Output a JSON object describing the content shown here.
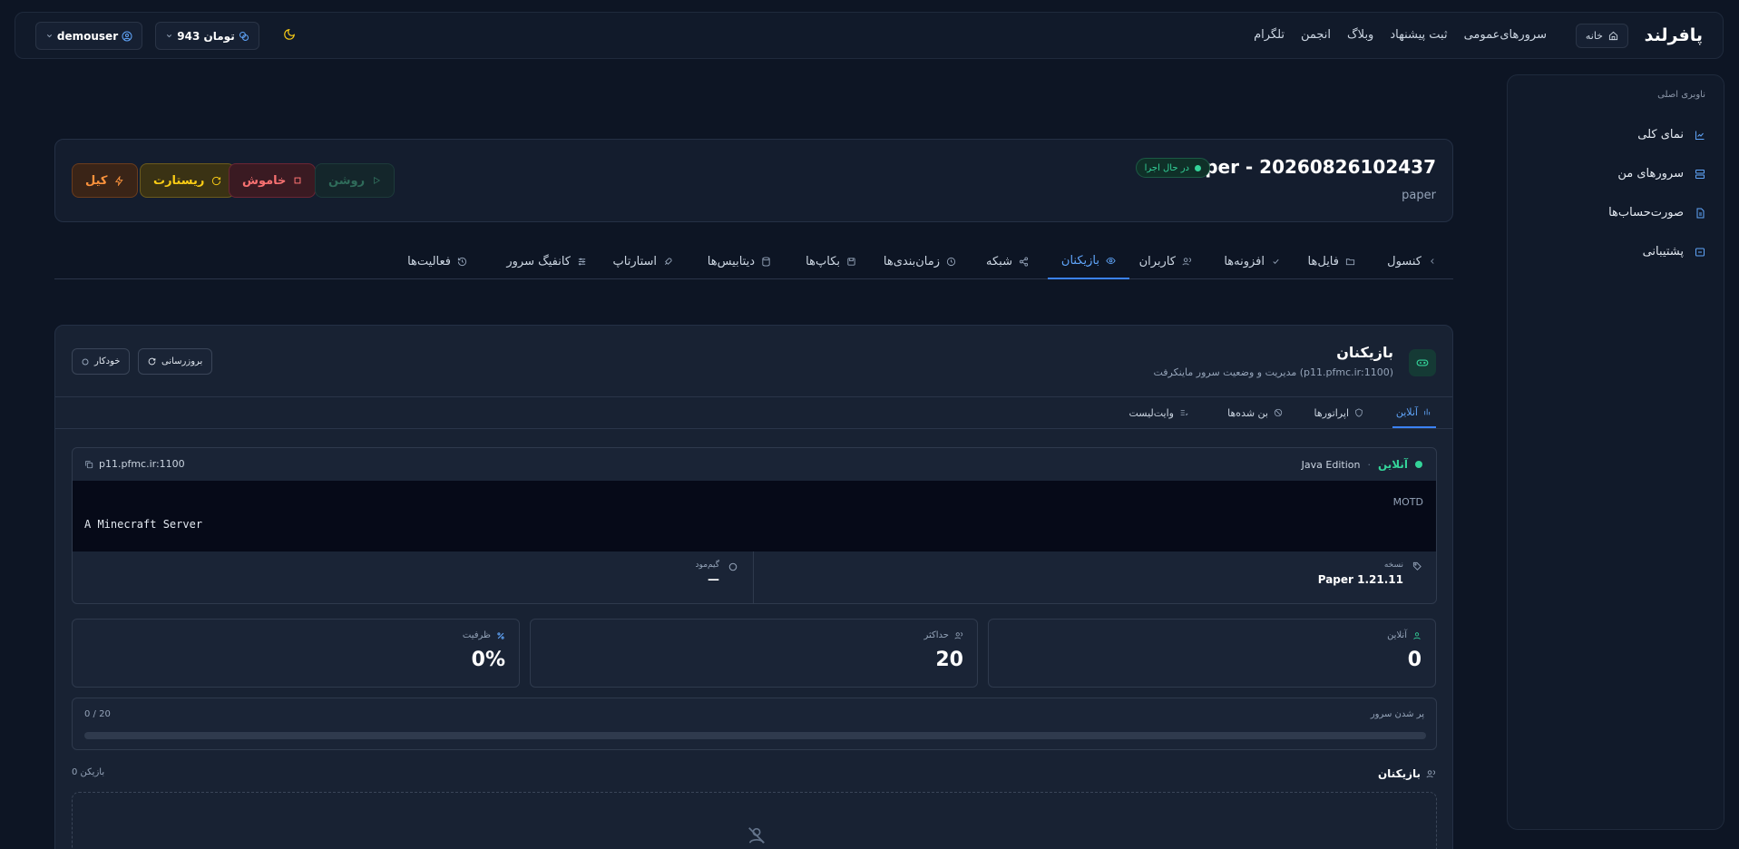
{
  "topbar": {
    "brand": "پافرلند",
    "home_label": "خانه",
    "links": [
      "سرورهای‌عمومی",
      "ثبت پیشنهاد",
      "وبلاگ",
      "انجمن",
      "تلگرام"
    ],
    "balance": "943 تومان",
    "username": "demouser"
  },
  "sidebar": {
    "title": "ناوبری اصلی",
    "items": [
      {
        "label": "نمای کلی",
        "icon": "chart-icon"
      },
      {
        "label": "سرورهای من",
        "icon": "server-icon"
      },
      {
        "label": "صورت‌حساب‌ها",
        "icon": "invoice-icon"
      },
      {
        "label": "پشتیبانی",
        "icon": "support-icon"
      }
    ]
  },
  "header": {
    "title": "paper - 20260826102437",
    "subtitle": "paper",
    "status": "در حال اجرا",
    "buttons": {
      "start": "روشن",
      "stop": "خاموش",
      "restart": "ریستارت",
      "kill": "کیل"
    }
  },
  "tabs": [
    {
      "label": "کنسول",
      "icon": "chevron-left-icon"
    },
    {
      "label": "فایل‌ها",
      "icon": "folder-icon"
    },
    {
      "label": "افزونه‌ها",
      "icon": "plug-icon"
    },
    {
      "label": "کاربران",
      "icon": "users-icon"
    },
    {
      "label": "بازیکنان",
      "icon": "eye-icon",
      "active": true
    },
    {
      "label": "شبکه",
      "icon": "share-icon"
    },
    {
      "label": "زمان‌بندی‌ها",
      "icon": "clock-icon"
    },
    {
      "label": "بکاپ‌ها",
      "icon": "save-icon"
    },
    {
      "label": "دیتابیس‌ها",
      "icon": "database-icon"
    },
    {
      "label": "استارتاپ",
      "icon": "rocket-icon"
    },
    {
      "label": "کانفیگ سرور",
      "icon": "sliders-icon"
    },
    {
      "label": "فعالیت‌ها",
      "icon": "history-icon"
    }
  ],
  "players": {
    "title": "بازیکنان",
    "subtitle": "مدیریت و وضعیت سرور ماینکرفت (p11.pfmc.ir:1100)",
    "refresh_label": "بروزرسانی",
    "auto_label": "خودکار",
    "subtabs": [
      {
        "label": "آنلاین",
        "active": true
      },
      {
        "label": "اپراتورها"
      },
      {
        "label": "بن شده‌ها"
      },
      {
        "label": "وایت‌لیست"
      }
    ],
    "status_text": "آنلاین",
    "edition": "Java Edition",
    "address": "p11.pfmc.ir:1100",
    "motd_label": "MOTD",
    "motd_text": "A Minecraft Server",
    "version_label": "نسخه",
    "version_value": "Paper 1.21.11",
    "gamemode_label": "گیم‌مود",
    "gamemode_value": "—",
    "stats": {
      "online_label": "آنلاین",
      "online_value": "0",
      "max_label": "حداکثر",
      "max_value": "20",
      "capacity_label": "ظرفیت",
      "capacity_value": "0%"
    },
    "fill_label": "پر شدن سرور",
    "fill_text": "0 / 20",
    "fill_fraction": 0,
    "list_title": "بازیکنان",
    "list_count": "0 بازیکن"
  },
  "colors": {
    "accent": "#3b82f6",
    "success": "#34d399",
    "warning": "#facc15",
    "danger": "#f87171",
    "kill": "#fb923c"
  }
}
